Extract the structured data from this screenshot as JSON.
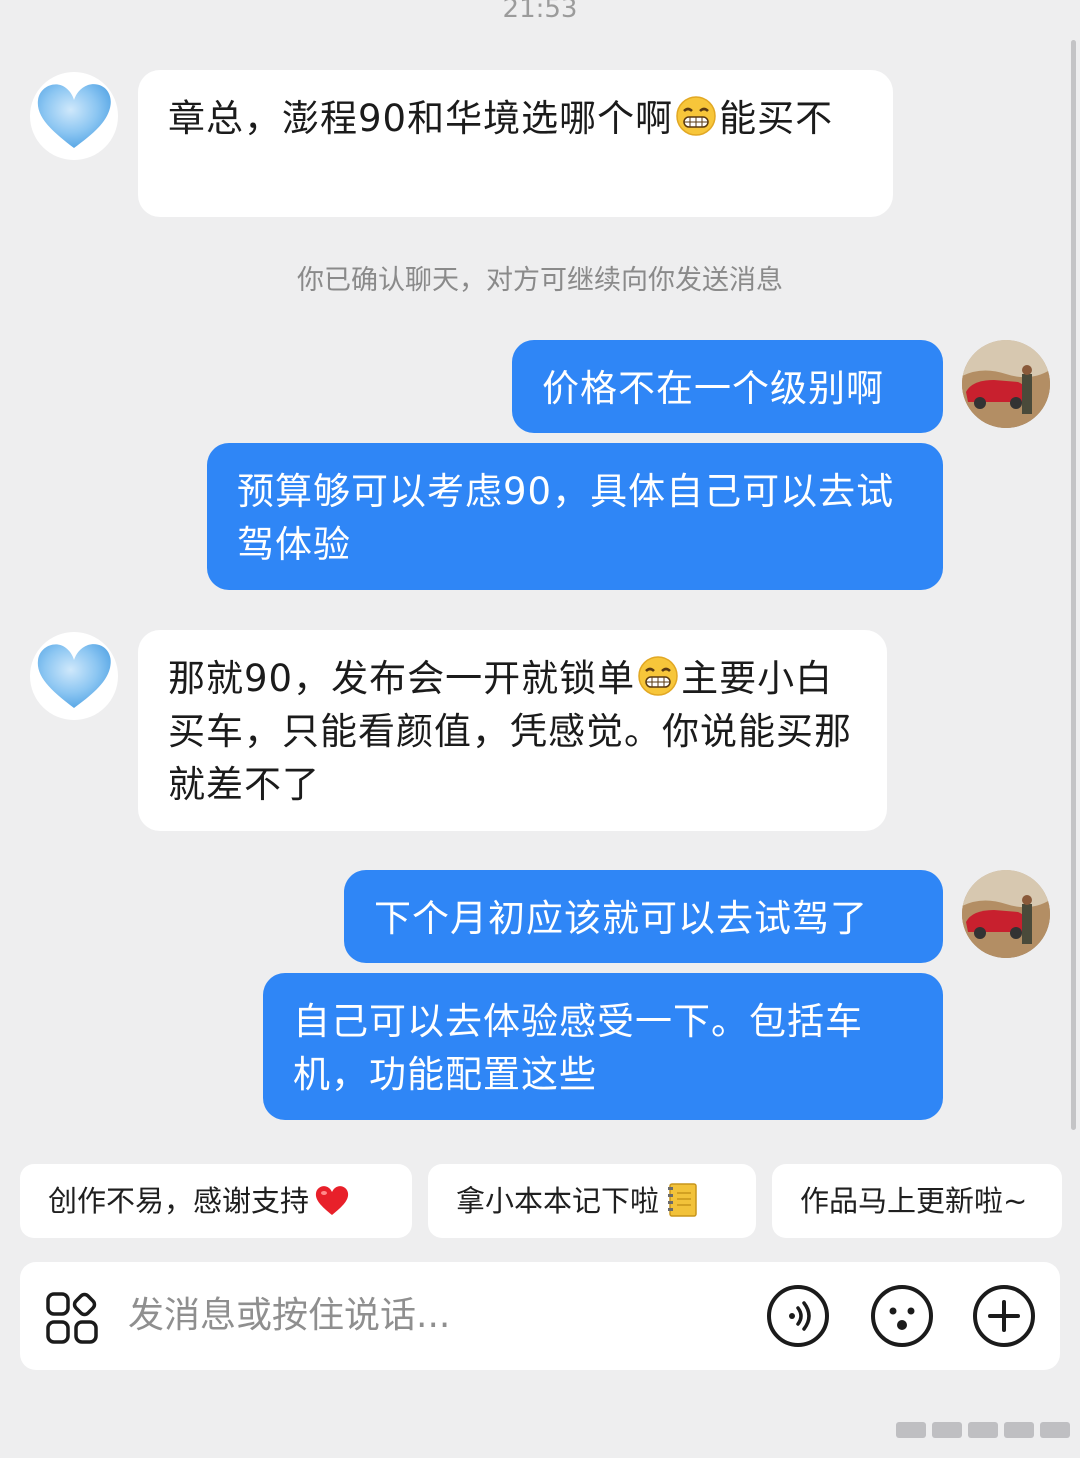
{
  "status": {
    "time": "21:53"
  },
  "messages": [
    {
      "side": "in",
      "avatar": "blue-heart-avatar",
      "text_before": "章总，澎程90和华境选哪个啊",
      "emoji": "grinning-face",
      "text_after": "能买不"
    },
    {
      "side": "out",
      "avatar": "user-photo-avatar",
      "text": "价格不在一个级别啊"
    },
    {
      "side": "out",
      "text": "预算够可以考虑90，具体自己可以去试驾体验"
    },
    {
      "side": "in",
      "avatar": "blue-heart-avatar",
      "text_before": "那就90，发布会一开就锁单",
      "emoji": "grinning-face",
      "text_after": "主要小白买车，只能看颜值，凭感觉。你说能买那就差不了"
    },
    {
      "side": "out",
      "avatar": "user-photo-avatar",
      "text": "下个月初应该就可以去试驾了"
    },
    {
      "side": "out",
      "text": "自己可以去体验感受一下。包括车机，功能配置这些"
    }
  ],
  "system_notice": "你已确认聊天，对方可继续向你发送消息",
  "quick_replies": [
    {
      "label": "创作不易，感谢支持",
      "emoji": "red-heart"
    },
    {
      "label": "拿小本本记下啦",
      "emoji": "notebook"
    },
    {
      "label": "作品马上更新啦~",
      "emoji": ""
    }
  ],
  "composer": {
    "placeholder": "发消息或按住说话...",
    "icons": [
      "apps-icon",
      "voice-icon",
      "emoji-icon",
      "plus-icon"
    ]
  },
  "colors": {
    "accent": "#2f86f6",
    "background": "#eeeeef",
    "incoming": "#ffffff"
  }
}
